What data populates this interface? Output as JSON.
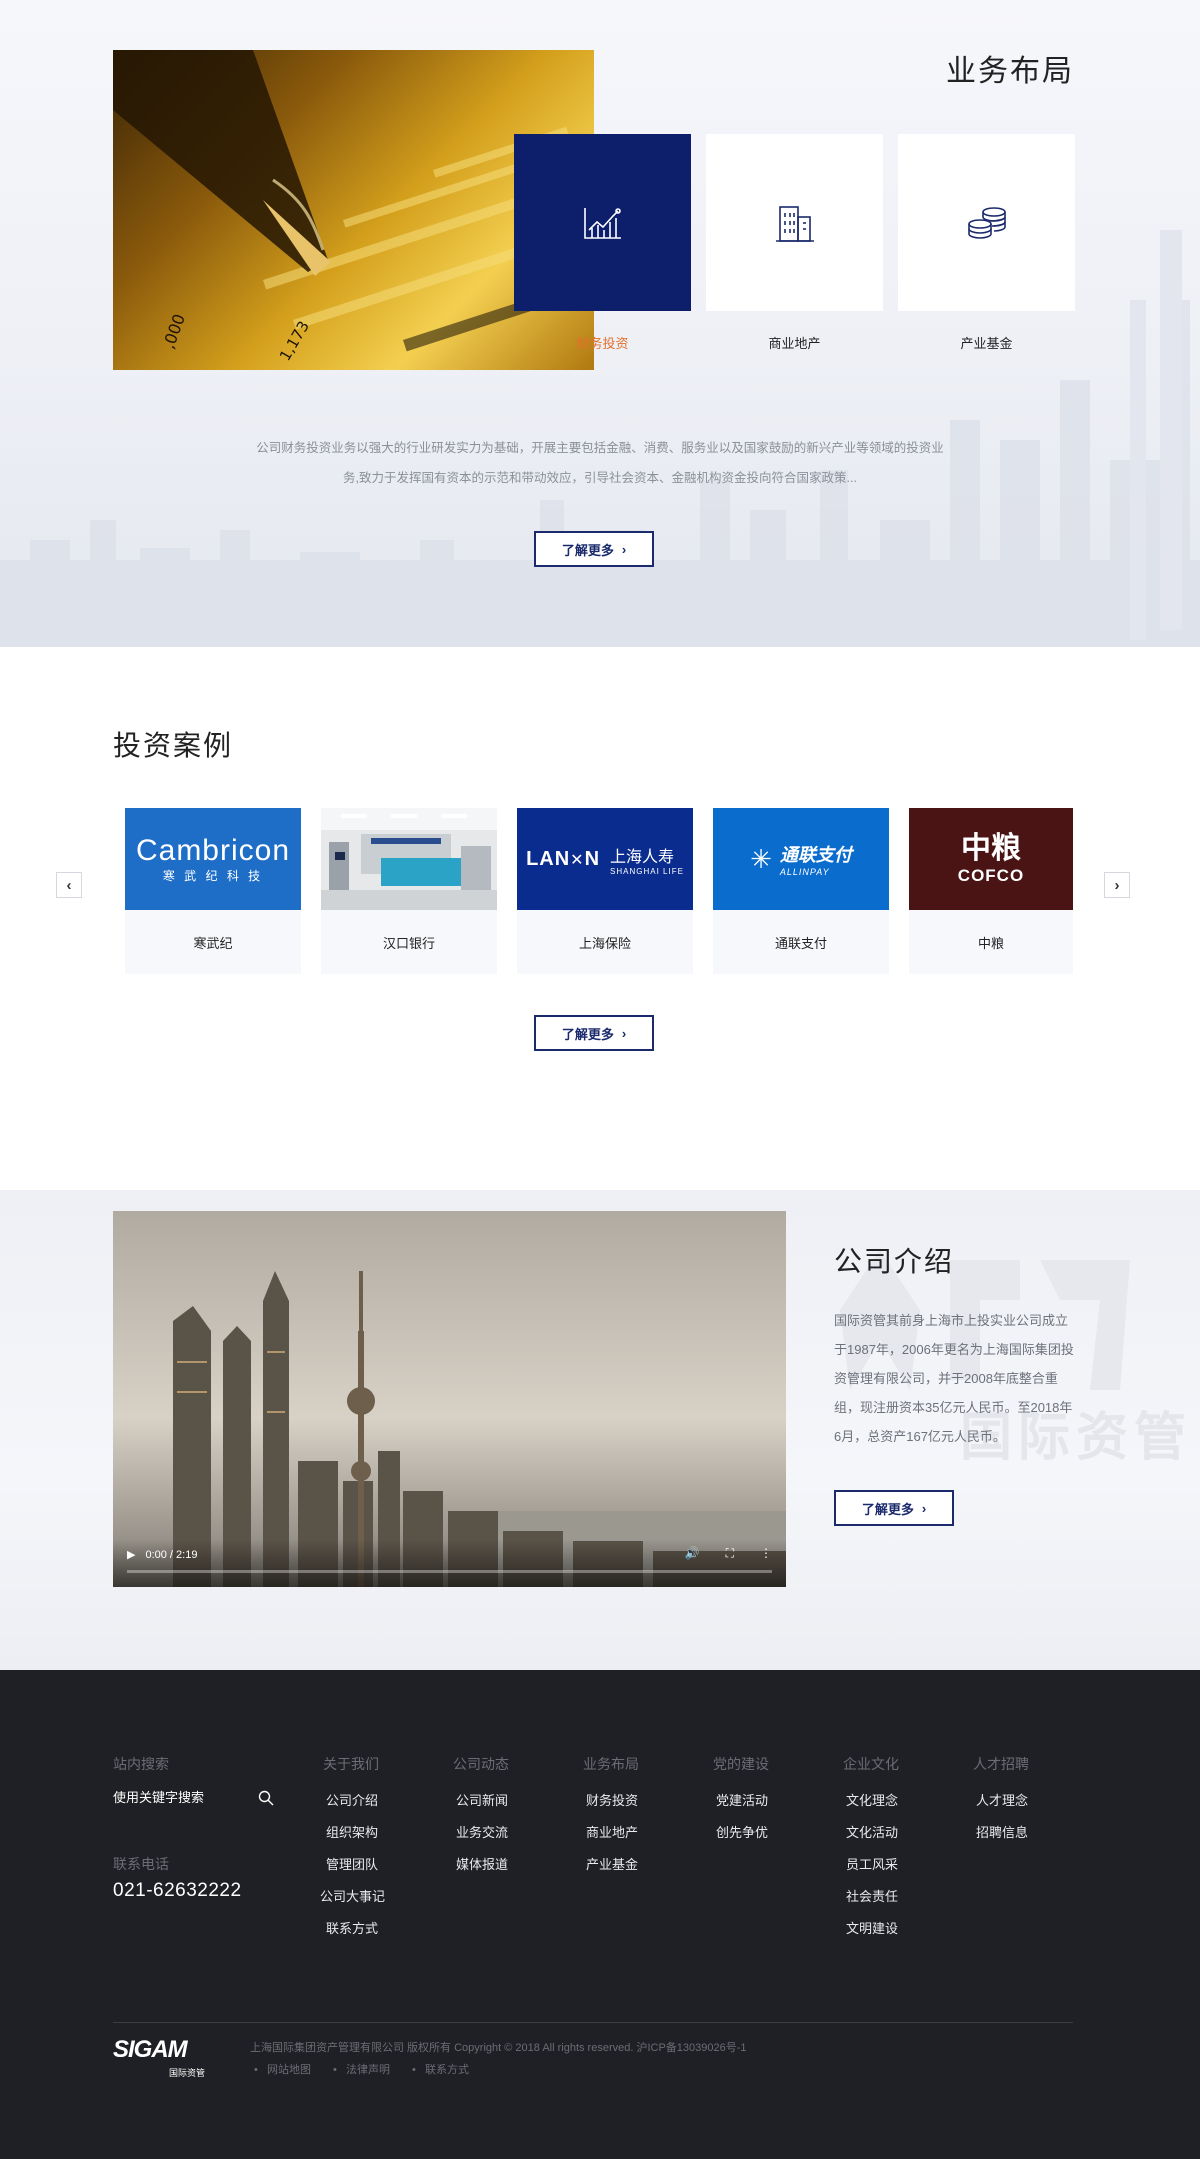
{
  "business": {
    "title": "业务布局",
    "items": [
      {
        "label": "财务投资",
        "icon": "chart-trend-icon",
        "active": true
      },
      {
        "label": "商业地产",
        "icon": "building-icon",
        "active": false
      },
      {
        "label": "产业基金",
        "icon": "coin-stack-icon",
        "active": false
      }
    ],
    "description_line1": "公司财务投资业务以强大的行业研发实力为基础，开展主要包括金融、消费、服务业以及国家鼓励的新兴产业等领域的投资业",
    "description_line2": "务,致力于发挥国有资本的示范和带动效应，引导社会资本、金融机构资金投向符合国家政策...",
    "more_label": "了解更多"
  },
  "cases": {
    "title": "投资案例",
    "items": [
      {
        "name": "寒武纪",
        "logo_main": "Cambricon",
        "logo_sub": "寒 武 纪 科 技",
        "color": "#1e6ec8"
      },
      {
        "name": "汉口银行",
        "color": "#dfe3e6"
      },
      {
        "name": "上海保险",
        "logo_main": "上海人寿",
        "logo_en": "SHANGHAI LIFE",
        "color": "#0b2c8f"
      },
      {
        "name": "通联支付",
        "logo_main": "通联支付",
        "logo_en": "ALLINPAY",
        "color": "#0a6ccd"
      },
      {
        "name": "中粮",
        "logo_main": "中粮",
        "logo_en": "COFCO",
        "color": "#4a1415"
      }
    ],
    "more_label": "了解更多",
    "prev_icon": "chevron-left-icon",
    "next_icon": "chevron-right-icon"
  },
  "intro": {
    "title": "公司介绍",
    "text": "国际资管其前身上海市上投实业公司成立于1987年，2006年更名为上海国际集团投资管理有限公司，并于2008年底整合重组，现注册资本35亿元人民币。至2018年6月，总资产167亿元人民币。",
    "more_label": "了解更多",
    "watermark": "国际资管",
    "video": {
      "time": "0:00 / 2:19",
      "progress": 0
    }
  },
  "footer": {
    "search_heading": "站内搜索",
    "search_placeholder": "使用关键字搜索",
    "phone_heading": "联系电话",
    "phone": "021-62632222",
    "columns": [
      {
        "heading": "关于我们",
        "links": [
          "公司介绍",
          "组织架构",
          "管理团队",
          "公司大事记",
          "联系方式"
        ]
      },
      {
        "heading": "公司动态",
        "links": [
          "公司新闻",
          "业务交流",
          "媒体报道"
        ]
      },
      {
        "heading": "业务布局",
        "links": [
          "财务投资",
          "商业地产",
          "产业基金"
        ]
      },
      {
        "heading": "党的建设",
        "links": [
          "党建活动",
          "创先争优"
        ]
      },
      {
        "heading": "企业文化",
        "links": [
          "文化理念",
          "文化活动",
          "员工风采",
          "社会责任",
          "文明建设"
        ]
      },
      {
        "heading": "人才招聘",
        "links": [
          "人才理念",
          "招聘信息"
        ]
      }
    ],
    "logo_text": "SIGAM",
    "logo_sub": "国际资管",
    "copyright": "上海国际集团资产管理有限公司 版权所有 Copyright © 2018 All rights reserved. 沪ICP备13039026号-1",
    "bottom_links": [
      "网站地图",
      "法律声明",
      "联系方式"
    ]
  }
}
